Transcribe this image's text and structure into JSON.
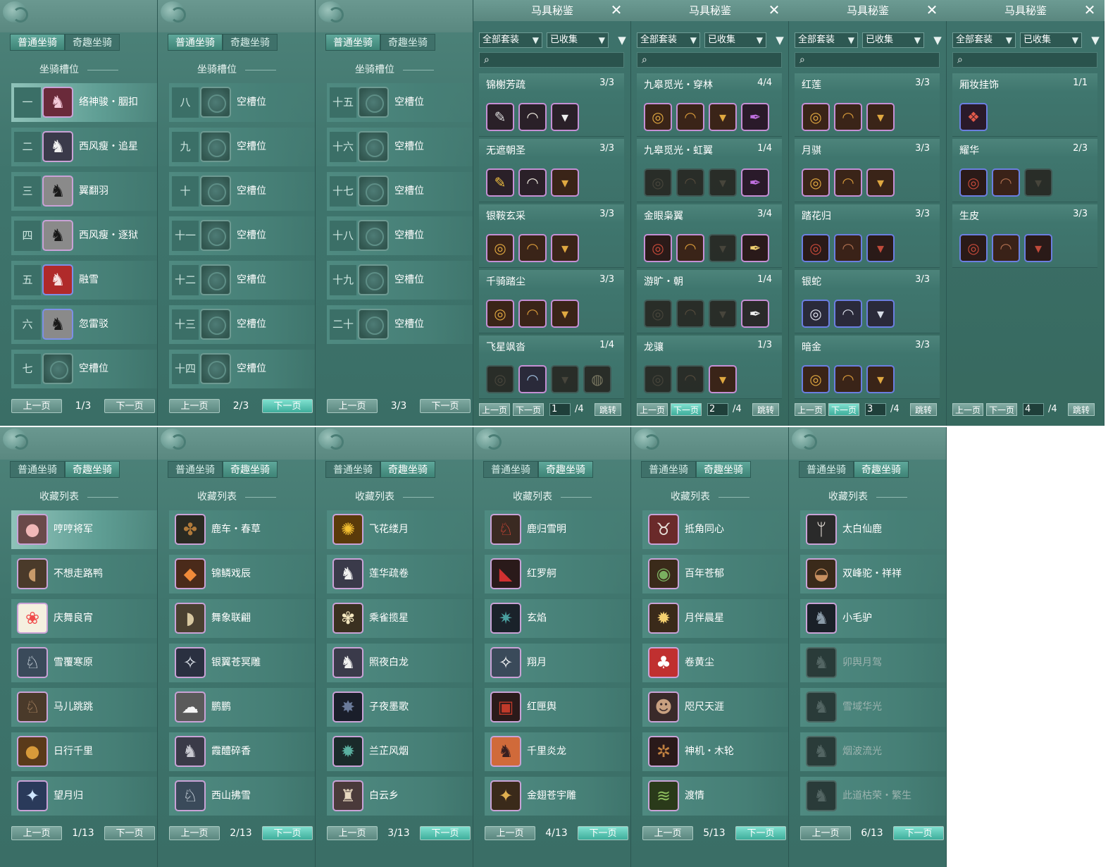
{
  "tabs": {
    "normal": "普通坐骑",
    "fun": "奇趣坐骑"
  },
  "labels": {
    "slot_section": "坐骑槽位",
    "collection_section": "收藏列表",
    "prev": "上一页",
    "next": "下一页",
    "gear_title": "马具秘鉴",
    "filter_all_sets": "全部套装",
    "filter_collected": "已收集",
    "jump": "跳转"
  },
  "slot_panels": [
    {
      "page": "1/3",
      "rows": [
        {
          "num": "一",
          "name": "络神骏・胭扣",
          "icon": "horse-pink",
          "selected": true
        },
        {
          "num": "二",
          "name": "西风瘦・追星",
          "icon": "horse-white"
        },
        {
          "num": "三",
          "name": "翼翻羽",
          "icon": "horse-black"
        },
        {
          "num": "四",
          "name": "西风瘦・逐狱",
          "icon": "horse-black"
        },
        {
          "num": "五",
          "name": "融雪",
          "icon": "horse-red",
          "blue": true
        },
        {
          "num": "六",
          "name": "忽雷驳",
          "icon": "horse-black",
          "blue": true
        },
        {
          "num": "七",
          "name": "空槽位",
          "empty": true
        }
      ]
    },
    {
      "page": "2/3",
      "next_hot": true,
      "rows": [
        {
          "num": "八",
          "name": "空槽位",
          "empty": true
        },
        {
          "num": "九",
          "name": "空槽位",
          "empty": true
        },
        {
          "num": "十",
          "name": "空槽位",
          "empty": true
        },
        {
          "num": "十一",
          "name": "空槽位",
          "empty": true
        },
        {
          "num": "十二",
          "name": "空槽位",
          "empty": true
        },
        {
          "num": "十三",
          "name": "空槽位",
          "empty": true
        },
        {
          "num": "十四",
          "name": "空槽位",
          "empty": true
        }
      ]
    },
    {
      "page": "3/3",
      "rows": [
        {
          "num": "十五",
          "name": "空槽位",
          "empty": true
        },
        {
          "num": "十六",
          "name": "空槽位",
          "empty": true
        },
        {
          "num": "十七",
          "name": "空槽位",
          "empty": true
        },
        {
          "num": "十八",
          "name": "空槽位",
          "empty": true
        },
        {
          "num": "十九",
          "name": "空槽位",
          "empty": true
        },
        {
          "num": "二十",
          "name": "空槽位",
          "empty": true
        }
      ]
    }
  ],
  "gear_panels": [
    {
      "page_input": "1",
      "total": "/4",
      "sets": [
        {
          "name": "锦榭芳疏",
          "count": "3/3",
          "items": [
            "whip",
            "saddle-white",
            "stirrup"
          ]
        },
        {
          "name": "无遮朝圣",
          "count": "3/3",
          "items": [
            "whip-gold",
            "saddle-white",
            "stirrup-gold"
          ]
        },
        {
          "name": "银鞍玄采",
          "count": "3/3",
          "items": [
            "bridle-gold",
            "saddle-gold",
            "stirrup-gold"
          ]
        },
        {
          "name": "千骑踏尘",
          "count": "3/3",
          "items": [
            "bridle-gold",
            "saddle-gold",
            "stirrup-gold"
          ]
        },
        {
          "name": "飞星飒沓",
          "count": "1/4",
          "items": [
            "bridle-dim",
            "saddle-blue",
            "stirrup-dim",
            "ring-dim"
          ]
        }
      ]
    },
    {
      "page_input": "2",
      "total": "/4",
      "next_hot": true,
      "sets": [
        {
          "name": "九皋觅光・穿林",
          "count": "4/4",
          "items": [
            "bridle-gold",
            "saddle-gold",
            "stirrup-gold",
            "plume-purple"
          ]
        },
        {
          "name": "九皋觅光・虹翼",
          "count": "1/4",
          "items": [
            "bridle-dim",
            "saddle-dim",
            "stirrup-dim",
            "plume-purple"
          ]
        },
        {
          "name": "金眼枭翼",
          "count": "3/4",
          "items": [
            "bridle-red",
            "saddle-gold",
            "stirrup-dim",
            "plume-gold"
          ]
        },
        {
          "name": "游旷・朝",
          "count": "1/4",
          "items": [
            "bridle-dim",
            "saddle-dim",
            "stirrup-dim",
            "plume-white"
          ]
        },
        {
          "name": "龙骧",
          "count": "1/3",
          "items": [
            "bridle-dim",
            "saddle-dim",
            "stirrup-gold"
          ]
        }
      ]
    },
    {
      "page_input": "3",
      "total": "/4",
      "next_hot": true,
      "sets": [
        {
          "name": "红莲",
          "count": "3/3",
          "items": [
            "bridle-gold",
            "saddle-gold",
            "stirrup-gold"
          ]
        },
        {
          "name": "月骐",
          "count": "3/3",
          "items": [
            "bridle-gold",
            "saddle-gold",
            "stirrup-gold"
          ]
        },
        {
          "name": "踏花归",
          "count": "3/3",
          "items": [
            "bridle-red",
            "saddle-brown",
            "stirrup-red"
          ],
          "blue": true
        },
        {
          "name": "银蛇",
          "count": "3/3",
          "items": [
            "bridle-silver",
            "saddle-silver",
            "stirrup-silver"
          ],
          "blue": true
        },
        {
          "name": "暗金",
          "count": "3/3",
          "items": [
            "bridle-gold",
            "saddle-gold",
            "stirrup-gold"
          ],
          "blue": true
        }
      ]
    },
    {
      "page_input": "4",
      "total": "/4",
      "sets": [
        {
          "name": "厢妆挂饰",
          "count": "1/1",
          "items": [
            "ornament-red"
          ],
          "blue": true
        },
        {
          "name": "耀华",
          "count": "2/3",
          "items": [
            "bridle-red",
            "saddle-brown",
            "stirrup-dim"
          ],
          "blue": true
        },
        {
          "name": "生皮",
          "count": "3/3",
          "items": [
            "bridle-red",
            "saddle-brown",
            "stirrup-red"
          ],
          "blue": true
        }
      ]
    }
  ],
  "collection_panels": [
    {
      "page": "1/13",
      "rows": [
        {
          "name": "哼哼将军",
          "icon": "pig",
          "selected": true
        },
        {
          "name": "不想走路鸭",
          "icon": "duck"
        },
        {
          "name": "庆舞良宵",
          "icon": "lion-dance"
        },
        {
          "name": "雪覆寒原",
          "icon": "deer-white"
        },
        {
          "name": "马儿跳跳",
          "icon": "toy-horse"
        },
        {
          "name": "日行千里",
          "icon": "bear"
        },
        {
          "name": "望月归",
          "icon": "crane"
        }
      ]
    },
    {
      "page": "2/13",
      "next_hot": true,
      "rows": [
        {
          "name": "鹿车・春草",
          "icon": "cart"
        },
        {
          "name": "锦鳞戏辰",
          "icon": "fish"
        },
        {
          "name": "舞象联翩",
          "icon": "elephant"
        },
        {
          "name": "银翼苍冥雕",
          "icon": "eagle"
        },
        {
          "name": "鹏鹏",
          "icon": "sheep"
        },
        {
          "name": "霞醴碎香",
          "icon": "horse-grey"
        },
        {
          "name": "西山拂雪",
          "icon": "deer-white"
        }
      ]
    },
    {
      "page": "3/13",
      "next_hot": true,
      "rows": [
        {
          "name": "飞花缕月",
          "icon": "gold-orb"
        },
        {
          "name": "莲华疏卷",
          "icon": "horse-white"
        },
        {
          "name": "乘雀揽星",
          "icon": "bird-gold"
        },
        {
          "name": "照夜白龙",
          "icon": "horse-white"
        },
        {
          "name": "子夜墨歌",
          "icon": "dragon-dark"
        },
        {
          "name": "兰芷风烟",
          "icon": "beast-teal"
        },
        {
          "name": "白云乡",
          "icon": "rider"
        }
      ]
    },
    {
      "page": "4/13",
      "next_hot": true,
      "rows": [
        {
          "name": "鹿归雪明",
          "icon": "deer-red"
        },
        {
          "name": "红罗舸",
          "icon": "boat-red"
        },
        {
          "name": "玄焰",
          "icon": "qilin"
        },
        {
          "name": "翔月",
          "icon": "bird-white"
        },
        {
          "name": "红匣舆",
          "icon": "carriage-red"
        },
        {
          "name": "千里炎龙",
          "icon": "horse-dark"
        },
        {
          "name": "金翅苍宇雕",
          "icon": "eagle-gold"
        }
      ]
    },
    {
      "page": "5/13",
      "next_hot": true,
      "rows": [
        {
          "name": "抵角同心",
          "icon": "ox"
        },
        {
          "name": "百年苍郁",
          "icon": "tortoise"
        },
        {
          "name": "月伴晨星",
          "icon": "lantern"
        },
        {
          "name": "卷黄尘",
          "icon": "chicken"
        },
        {
          "name": "咫尺天涯",
          "icon": "monkey"
        },
        {
          "name": "神机・木轮",
          "icon": "wheel"
        },
        {
          "name": "渡情",
          "icon": "raft"
        }
      ]
    },
    {
      "page": "6/13",
      "next_hot": true,
      "rows": [
        {
          "name": "太白仙鹿",
          "icon": "antler"
        },
        {
          "name": "双峰驼・祥祥",
          "icon": "camel"
        },
        {
          "name": "小毛驴",
          "icon": "donkey"
        },
        {
          "name": "卯舆月驾",
          "icon": "dim",
          "dim": true
        },
        {
          "name": "雪域华光",
          "icon": "dim",
          "dim": true
        },
        {
          "name": "烟波流光",
          "icon": "dim",
          "dim": true
        },
        {
          "name": "此道枯荣・繁生",
          "icon": "dim",
          "dim": true
        }
      ]
    }
  ]
}
